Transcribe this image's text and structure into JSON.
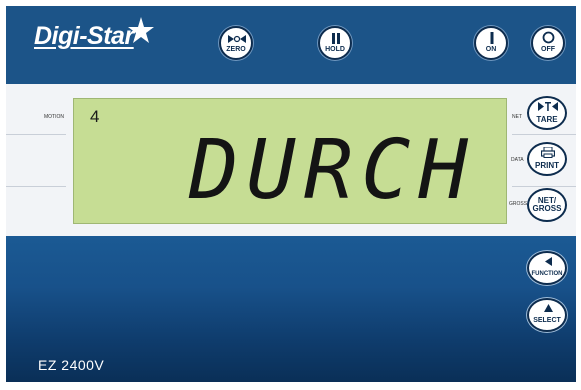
{
  "brand": {
    "logo_text": "Digi-Star"
  },
  "top_buttons": {
    "zero": {
      "label": "ZERO",
      "icon": "zero-arrows-icon"
    },
    "hold": {
      "label": "HOLD",
      "icon": "pause-icon"
    },
    "on": {
      "label": "ON",
      "icon": "power-on-icon"
    },
    "off": {
      "label": "OFF",
      "icon": "power-off-icon"
    }
  },
  "display": {
    "mode_number": "4",
    "main_text": "DURCH",
    "annunciators": {
      "motion": "MOTION",
      "net": "NET",
      "data": "DATA",
      "gross": "GROSS"
    }
  },
  "side_buttons": {
    "tare": {
      "label": "TARE",
      "icon": "tare-arrows-icon"
    },
    "print": {
      "label": "PRINT",
      "icon": "printer-icon"
    },
    "netgross": {
      "label_top": "NET/",
      "label_bottom": "GROSS"
    },
    "function": {
      "label": "FUNCTION",
      "icon": "left-arrow-icon"
    },
    "select": {
      "label": "SELECT",
      "icon": "up-arrow-icon"
    }
  },
  "model": "EZ 2400V",
  "colors": {
    "panel_blue": "#1c5488",
    "lcd_green": "#c6dd94",
    "button_navy": "#0d2c4e"
  }
}
